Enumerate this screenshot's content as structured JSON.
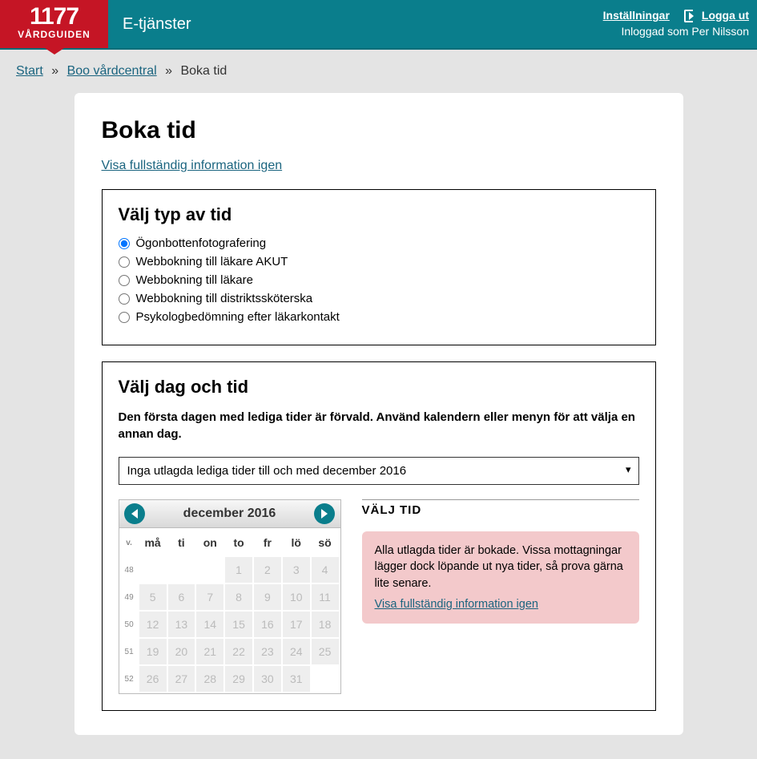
{
  "header": {
    "logo_big": "1177",
    "logo_small": "VÅRDGUIDEN",
    "service": "E-tjänster",
    "settings": "Inställningar",
    "logout": "Logga ut",
    "logged_in_as": "Inloggad som Per Nilsson"
  },
  "breadcrumbs": {
    "start": "Start",
    "center": "Boo vårdcentral",
    "current": "Boka tid"
  },
  "page": {
    "title": "Boka tid",
    "show_full_info": "Visa fullständig information igen"
  },
  "section_type": {
    "heading": "Välj typ av tid",
    "options": [
      "Ögonbottenfotografering",
      "Webbokning till läkare AKUT",
      "Webbokning till läkare",
      "Webbokning till distriktssköterska",
      "Psykologbedömning efter läkarkontakt"
    ],
    "selected": 0
  },
  "section_day": {
    "heading": "Välj dag och tid",
    "instruction": "Den första dagen med lediga tider är förvald. Använd kalendern eller menyn för att välja en annan dag.",
    "dropdown_value": "Inga utlagda lediga tider till och med december 2016"
  },
  "calendar": {
    "title": "december 2016",
    "week_header": "v.",
    "day_headers": [
      "må",
      "ti",
      "on",
      "to",
      "fr",
      "lö",
      "sö"
    ],
    "weeks": [
      {
        "num": "48",
        "days": [
          "",
          "",
          "",
          "1",
          "2",
          "3",
          "4"
        ]
      },
      {
        "num": "49",
        "days": [
          "5",
          "6",
          "7",
          "8",
          "9",
          "10",
          "11"
        ]
      },
      {
        "num": "50",
        "days": [
          "12",
          "13",
          "14",
          "15",
          "16",
          "17",
          "18"
        ]
      },
      {
        "num": "51",
        "days": [
          "19",
          "20",
          "21",
          "22",
          "23",
          "24",
          "25"
        ]
      },
      {
        "num": "52",
        "days": [
          "26",
          "27",
          "28",
          "29",
          "30",
          "31",
          ""
        ]
      }
    ]
  },
  "time": {
    "heading": "VÄLJ TID",
    "info_text": "Alla utlagda tider är bokade. Vissa mottagningar lägger dock löpande ut nya tider, så prova gärna lite senare.",
    "info_link": "Visa fullständig information igen"
  }
}
